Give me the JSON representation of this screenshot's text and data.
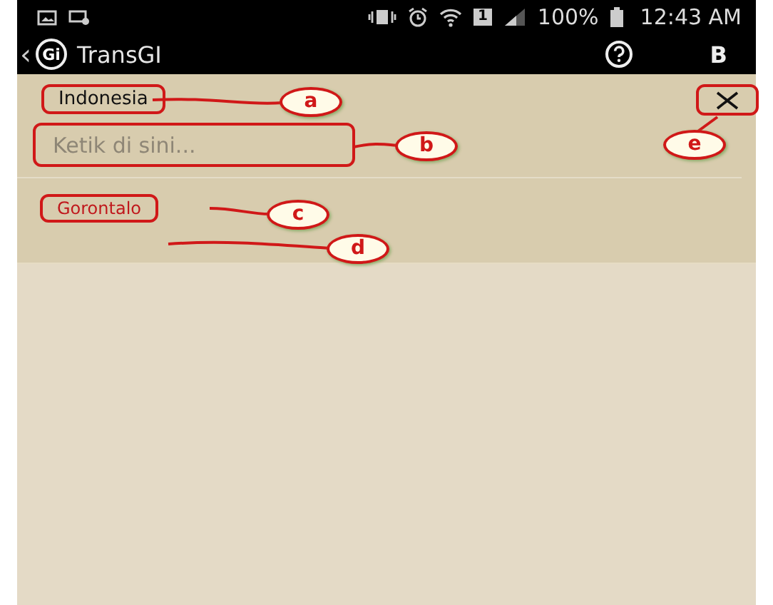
{
  "status_bar": {
    "battery_text": "100%",
    "time": "12:43 AM",
    "sim_text": "1"
  },
  "app_bar": {
    "back": "‹",
    "logo_text": "Gi",
    "title": "TransGI",
    "action": "B"
  },
  "source_language": "Indonesia",
  "input": {
    "placeholder": "Ketik di sini..."
  },
  "target_language": "Gorontalo",
  "callouts": [
    {
      "letter": "a"
    },
    {
      "letter": "b"
    },
    {
      "letter": "c"
    },
    {
      "letter": "d"
    },
    {
      "letter": "e"
    }
  ]
}
